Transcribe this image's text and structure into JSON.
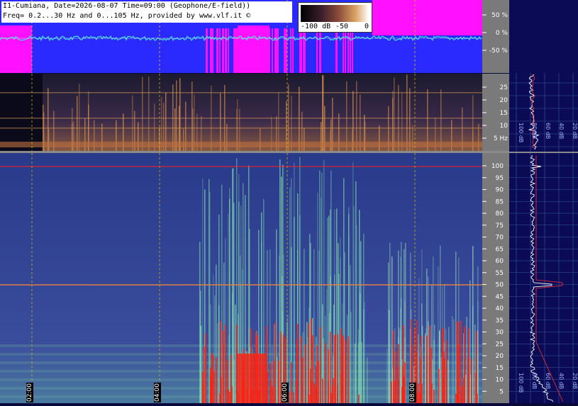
{
  "header": {
    "line1": "I1-Cumiana, Date=2026-08-07 Time=09:00 (Geophone/E-field))",
    "line2": "Freq= 0.2...30 Hz and 0...105 Hz, provided by www.vlf.it ©"
  },
  "colorscale": {
    "labels": [
      "-100 dB",
      "-50",
      "0"
    ]
  },
  "colors": {
    "waveform_bg": "#2a2aff",
    "magenta": "#ff10ff",
    "cyan": "#40e0e0",
    "axis_gray": "#7a7a7a",
    "red_line": "#ff2020"
  },
  "chart_data": [
    {
      "type": "line",
      "panel": "waveform",
      "y_ticks": [
        "50 %",
        "0 %",
        "-50 %"
      ],
      "ylim": [
        -100,
        100
      ]
    },
    {
      "type": "heatmap",
      "panel": "spectrogram-low",
      "y_ticks": [
        "25",
        "20",
        "15",
        "10",
        "5 Hz"
      ],
      "ylim": [
        0,
        30
      ]
    },
    {
      "type": "heatmap",
      "panel": "spectrogram-high",
      "y_ticks": [
        "100",
        "95",
        "90",
        "85",
        "80",
        "75",
        "70",
        "65",
        "60",
        "55",
        "50",
        "45",
        "40",
        "35",
        "30",
        "25",
        "20",
        "15",
        "10",
        "5"
      ],
      "ylim": [
        0,
        105
      ],
      "x_ticks": [
        "02:00",
        "04:00",
        "06:00",
        "08:00"
      ]
    },
    {
      "type": "line",
      "panel": "spectrum-profile",
      "x_ticks_low": [
        "100 dB",
        "80 dB",
        "60 dB",
        "40 dB",
        "20 dB"
      ],
      "x_ticks_high": [
        "100 dB",
        "80 dB",
        "60 dB",
        "40 dB",
        "20 dB"
      ]
    }
  ]
}
